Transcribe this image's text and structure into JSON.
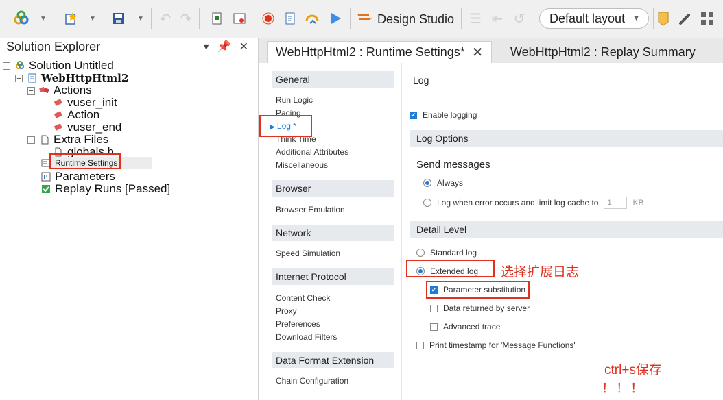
{
  "toolbar": {
    "design_studio_label": "Design Studio",
    "layout_value": "Default layout"
  },
  "solution_explorer": {
    "title": "Solution Explorer",
    "tree": {
      "solution": "Solution Untitled",
      "script": "WebHttpHtml2",
      "actions": "Actions",
      "vuser_init": "vuser_init",
      "action": "Action",
      "vuser_end": "vuser_end",
      "extra_files": "Extra Files",
      "globals": "globals.h",
      "runtime_settings": "Runtime Settings",
      "parameters": "Parameters",
      "replay_runs": "Replay Runs [Passed]"
    }
  },
  "tabs": {
    "active": "WebHttpHtml2 : Runtime Settings*",
    "replay": "WebHttpHtml2 : Replay Summary"
  },
  "nav": {
    "general": "General",
    "run_logic": "Run Logic",
    "pacing": "Pacing",
    "log": "Log *",
    "think_time": "Think Time",
    "additional_attributes": "Additional Attributes",
    "miscellaneous": "Miscellaneous",
    "browser": "Browser",
    "browser_emulation": "Browser Emulation",
    "network": "Network",
    "speed_simulation": "Speed Simulation",
    "internet_protocol": "Internet Protocol",
    "content_check": "Content Check",
    "proxy": "Proxy",
    "preferences": "Preferences",
    "download_filters": "Download Filters",
    "data_format_extension": "Data Format Extension",
    "chain_configuration": "Chain Configuration"
  },
  "log": {
    "title": "Log",
    "enable_logging": "Enable logging",
    "log_options": "Log Options",
    "send_messages": "Send messages",
    "always": "Always",
    "log_when_error": "Log when error occurs and limit log cache to",
    "cache_value": "1",
    "cache_unit": "KB",
    "detail_level": "Detail Level",
    "standard_log": "Standard log",
    "extended_log": "Extended log",
    "parameter_substitution": "Parameter substitution",
    "data_returned": "Data returned by server",
    "advanced_trace": "Advanced trace",
    "print_timestamp": "Print timestamp for 'Message Functions'"
  },
  "annotations": {
    "select_extended": "选择扩展日志",
    "save_hint": "ctrl+s保存",
    "save_exclaim": "！！！"
  },
  "colors": {
    "accent": "#1e7bd6",
    "annotation_red": "#e0301e"
  }
}
